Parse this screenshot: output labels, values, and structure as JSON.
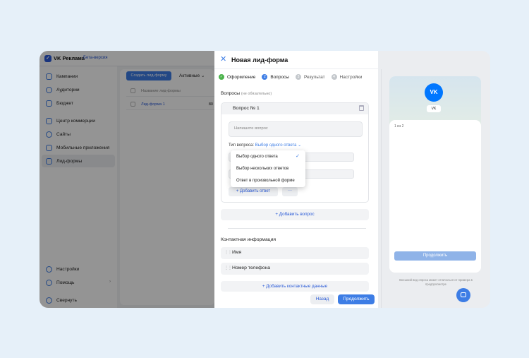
{
  "app": {
    "brand": "VK Реклама",
    "beta": "Бета-версия",
    "sidebar": {
      "items": [
        {
          "label": "Кампании"
        },
        {
          "label": "Аудитории"
        },
        {
          "label": "Бюджет"
        },
        {
          "label": "Центр коммерции"
        },
        {
          "label": "Сайты"
        },
        {
          "label": "Мобильные приложения"
        },
        {
          "label": "Лид-формы"
        }
      ],
      "bottom": [
        {
          "label": "Настройки"
        },
        {
          "label": "Помощь"
        },
        {
          "label": "Свернуть"
        }
      ]
    },
    "content": {
      "create_button": "Создать лид-форму",
      "filter": "Активные",
      "table": {
        "header": "Название лид-формы",
        "rows": [
          {
            "name": "Лид-форма 1",
            "value": "80"
          }
        ]
      }
    }
  },
  "modal": {
    "title": "Новая лид-форма",
    "steps": [
      {
        "num": "✓",
        "label": "Оформление",
        "state": "done"
      },
      {
        "num": "2",
        "label": "Вопросы",
        "state": "current"
      },
      {
        "num": "3",
        "label": "Результат",
        "state": "todo"
      },
      {
        "num": "4",
        "label": "Настройки",
        "state": "todo"
      }
    ],
    "questions_title": "Вопросы",
    "questions_optional": "(не обязательно)",
    "question": {
      "title": "Вопрос № 1",
      "placeholder": "Напишите вопрос",
      "type_label": "Тип вопроса:",
      "type_value": "Выбор одного ответа",
      "add_answer": "Добавить ответ",
      "more": "···"
    },
    "dropdown": {
      "options": [
        "Выбор одного ответа",
        "Выбор нескольких ответов",
        "Ответ в произвольной форме"
      ],
      "selected": "Выбор одного ответа"
    },
    "add_question": "Добавить вопрос",
    "contact_title": "Контактная информация",
    "contact_fields": [
      {
        "label": "Имя"
      },
      {
        "label": "Номер телефона"
      }
    ],
    "add_contact": "Добавить контактные данные",
    "back": "Назад",
    "next": "Продолжить"
  },
  "preview": {
    "logo_text": "VK",
    "name_chip": "VK",
    "counter": "1 из 2",
    "button": "Продолжить",
    "note": "Внешний вид опроса может отличаться от примера в предпросмотре"
  },
  "colors": {
    "accent": "#3d7de5",
    "success": "#4bb34b",
    "vk_blue": "#0077ff"
  }
}
